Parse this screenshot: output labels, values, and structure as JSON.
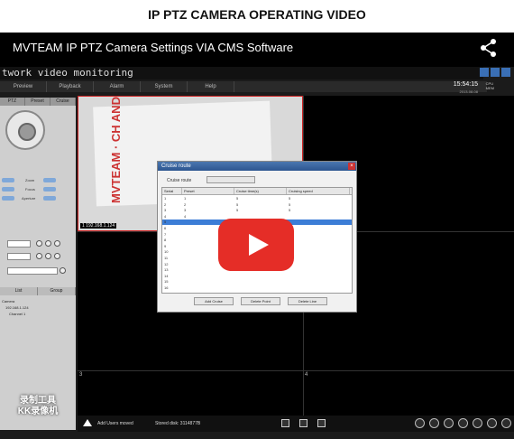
{
  "heading": "IP PTZ CAMERA OPERATING VIDEO",
  "video": {
    "title": "MVTEAM IP PTZ Camera Settings VIA CMS Software",
    "share_icon": "share-icon",
    "play_icon": "youtube-play-icon"
  },
  "cms": {
    "title": "twork video monitoring",
    "menu": [
      "Preview",
      "Playback",
      "Alarm",
      "System",
      "Help"
    ],
    "clock": {
      "time": "15:54:15",
      "date": "2013-08-08"
    },
    "cpu": {
      "label1": "CPU",
      "label2": "MEM"
    },
    "left_tabs": [
      "PTZ",
      "Preset",
      "Cruise"
    ],
    "ptz_labels": [
      "Zoom",
      "Focus",
      "Aperture"
    ],
    "device_tabs": [
      "List",
      "Group"
    ],
    "device_tree": [
      "Camera",
      "192.168.1.124",
      "Channel 1"
    ],
    "watermark": [
      "录制工具",
      "KK录像机"
    ],
    "feed_label": "1 192.168.1.124",
    "feed_text": "MVTEAM · CH AND DVR KIT",
    "cell_numbers": [
      "3",
      "4"
    ],
    "toolbar": {
      "tag": "Add Users moved",
      "info": "Stored disk: 3114877B"
    }
  },
  "dialog": {
    "title": "Cruise route",
    "mode_label": "Cruise route",
    "columns": [
      "Serial",
      "Preset",
      "Cruise time(s)",
      "Cruising speed"
    ],
    "rows": [
      [
        "1",
        "1",
        "5",
        "5"
      ],
      [
        "2",
        "2",
        "5",
        "5"
      ],
      [
        "3",
        "3",
        "5",
        "5"
      ],
      [
        "4",
        "4",
        "",
        ""
      ],
      [
        "5",
        "",
        "",
        ""
      ],
      [
        "6",
        "",
        "",
        ""
      ],
      [
        "7",
        "",
        "",
        ""
      ],
      [
        "8",
        "",
        "",
        ""
      ],
      [
        "9",
        "",
        "",
        ""
      ],
      [
        "10",
        "",
        "",
        ""
      ],
      [
        "11",
        "",
        "",
        ""
      ],
      [
        "12",
        "",
        "",
        ""
      ],
      [
        "13",
        "",
        "",
        ""
      ],
      [
        "14",
        "",
        "",
        ""
      ],
      [
        "15",
        "",
        "",
        ""
      ],
      [
        "16",
        "",
        "",
        ""
      ]
    ],
    "selected_row": 4,
    "buttons": [
      "Add Cruise",
      "Delete Point",
      "Delete Line"
    ]
  }
}
